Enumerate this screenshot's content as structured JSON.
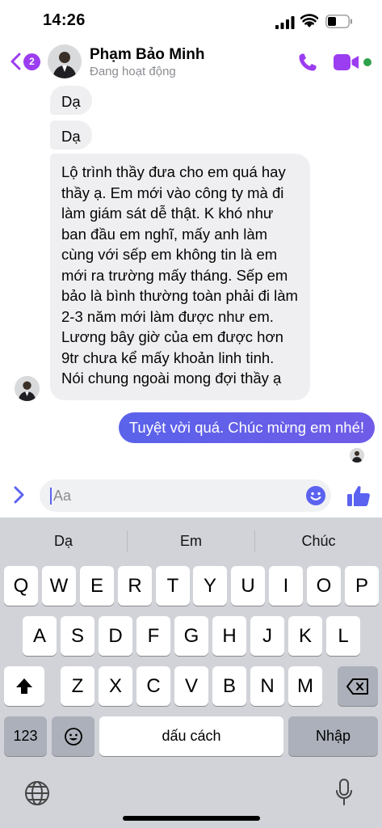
{
  "status_bar": {
    "time": "14:26"
  },
  "header": {
    "unread_count": "2",
    "contact_name": "Phạm Bảo Minh",
    "contact_status": "Đang hoạt động",
    "accent_color": "#9b3df0",
    "online_color": "#31a24c"
  },
  "messages": [
    {
      "direction": "incoming",
      "text": "Dạ"
    },
    {
      "direction": "incoming",
      "text": "Dạ"
    },
    {
      "direction": "incoming",
      "text": "Lộ trình thầy đưa cho em quá hay thầy ạ. Em mới vào công ty mà đi làm giám sát dễ thật. K khó như ban đầu em nghĩ, mấy anh làm cùng với sếp em không tin là em mới ra trường mấy tháng. Sếp em bảo là bình thường toàn phải đi làm 2-3 năm mới làm được như em. Lương bây giờ của em được hơn 9tr chưa kể mấy khoản linh tinh. Nói chung ngoài mong đợi thầy ạ"
    },
    {
      "direction": "outgoing",
      "text": "Tuyệt vời quá. Chúc mừng em nhé!"
    }
  ],
  "composer": {
    "placeholder": "Aa",
    "icons": [
      "chevron-right-icon",
      "emoji-icon",
      "thumbs-up-icon"
    ]
  },
  "keyboard": {
    "suggestions": [
      "Dạ",
      "Em",
      "Chúc"
    ],
    "row1": [
      "Q",
      "W",
      "E",
      "R",
      "T",
      "Y",
      "U",
      "I",
      "O",
      "P"
    ],
    "row2": [
      "A",
      "S",
      "D",
      "F",
      "G",
      "H",
      "J",
      "K",
      "L"
    ],
    "row3": [
      "Z",
      "X",
      "C",
      "V",
      "B",
      "N",
      "M"
    ],
    "numbers_key": "123",
    "space_key": "dấu cách",
    "return_key": "Nhập"
  }
}
